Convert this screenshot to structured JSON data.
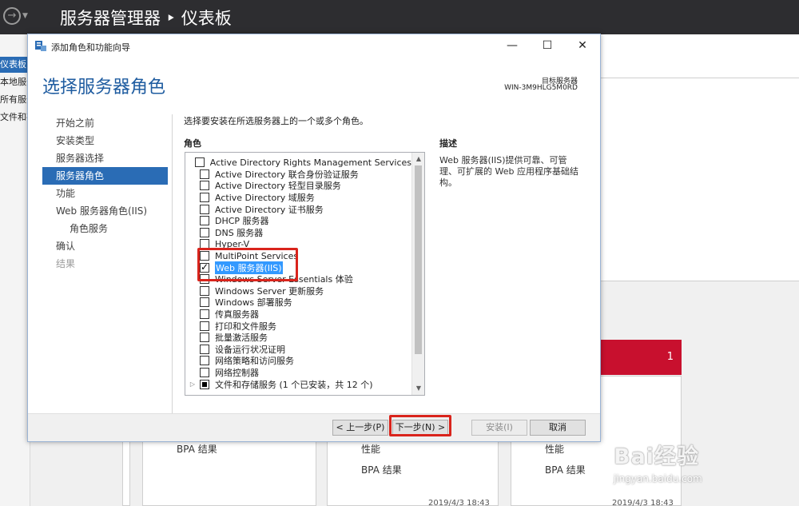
{
  "server_manager": {
    "title": "服务器管理器 ‣ 仪表板",
    "sidebar": [
      {
        "label": "仪表板",
        "active": true
      },
      {
        "label": "本地服务器",
        "active": false
      },
      {
        "label": "所有服务器",
        "active": false
      },
      {
        "label": "文件和存储服务",
        "active": false
      }
    ],
    "tiles": {
      "red_count": "1",
      "bpa_label": "BPA 结果",
      "perf_label": "性能",
      "timestamp": "2019/4/3 18:43"
    }
  },
  "wizard": {
    "window_title": "添加角色和功能向导",
    "heading": "选择服务器角色",
    "target_server_label": "目标服务器",
    "target_server_name": "WIN-3M9HLG5M0RD",
    "nav": [
      {
        "label": "开始之前",
        "state": "normal"
      },
      {
        "label": "安装类型",
        "state": "normal"
      },
      {
        "label": "服务器选择",
        "state": "normal"
      },
      {
        "label": "服务器角色",
        "state": "active"
      },
      {
        "label": "功能",
        "state": "normal"
      },
      {
        "label": "Web 服务器角色(IIS)",
        "state": "normal"
      },
      {
        "label": "角色服务",
        "state": "sub"
      },
      {
        "label": "确认",
        "state": "normal"
      },
      {
        "label": "结果",
        "state": "disabled"
      }
    ],
    "intro": "选择要安装在所选服务器上的一个或多个角色。",
    "roles_header": "角色",
    "description_header": "描述",
    "description_text": "Web 服务器(IIS)提供可靠、可管理、可扩展的 Web 应用程序基础结构。",
    "roles": [
      {
        "label": "Active Directory Rights Management Services",
        "checked": false
      },
      {
        "label": "Active Directory 联合身份验证服务",
        "checked": false
      },
      {
        "label": "Active Directory 轻型目录服务",
        "checked": false
      },
      {
        "label": "Active Directory 域服务",
        "checked": false
      },
      {
        "label": "Active Directory 证书服务",
        "checked": false
      },
      {
        "label": "DHCP 服务器",
        "checked": false
      },
      {
        "label": "DNS 服务器",
        "checked": false
      },
      {
        "label": "Hyper-V",
        "checked": false
      },
      {
        "label": "MultiPoint Services",
        "checked": false
      },
      {
        "label": "Web 服务器(IIS)",
        "checked": true
      },
      {
        "label": "Windows Server Essentials 体验",
        "checked": false
      },
      {
        "label": "Windows Server 更新服务",
        "checked": false
      },
      {
        "label": "Windows 部署服务",
        "checked": false
      },
      {
        "label": "传真服务器",
        "checked": false
      },
      {
        "label": "打印和文件服务",
        "checked": false
      },
      {
        "label": "批量激活服务",
        "checked": false
      },
      {
        "label": "设备运行状况证明",
        "checked": false
      },
      {
        "label": "网络策略和访问服务",
        "checked": false
      },
      {
        "label": "网络控制器",
        "checked": false
      },
      {
        "label": "文件和存储服务 (1 个已安装，共 12 个)",
        "checked": "partial",
        "expandable": true
      }
    ],
    "buttons": {
      "prev": "< 上一步(P)",
      "next": "下一步(N) >",
      "install": "安装(I)",
      "cancel": "取消"
    }
  },
  "watermark": {
    "logo": "Bai经验",
    "url": "jingyan.baidu.com"
  }
}
